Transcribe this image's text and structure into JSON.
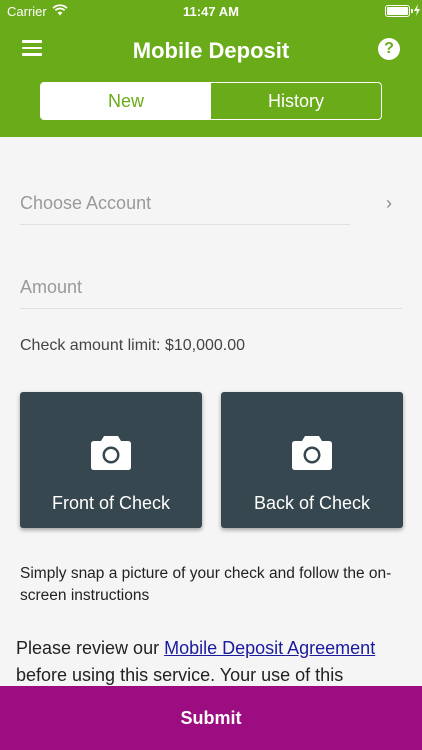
{
  "status_bar": {
    "carrier": "Carrier",
    "time": "11:47 AM"
  },
  "header": {
    "title": "Mobile Deposit"
  },
  "tabs": [
    {
      "label": "New",
      "active": true
    },
    {
      "label": "History",
      "active": false
    }
  ],
  "form": {
    "account_placeholder": "Choose Account",
    "amount_placeholder": "Amount",
    "limit_text": "Check amount limit: $10,000.00"
  },
  "checks": {
    "front_label": "Front of Check",
    "back_label": "Back of Check",
    "icon": "camera-icon"
  },
  "instructions": "Simply snap a picture of your check and follow the on-screen instructions",
  "agreement": {
    "prefix": "Please review our ",
    "link": "Mobile Deposit Agreement",
    "suffix": " before using this service. Your use of this"
  },
  "submit_label": "Submit",
  "colors": {
    "brand_green": "#6aab19",
    "card_dark": "#37474f",
    "submit_magenta": "#9c0d81",
    "link_blue": "#1a1a9e"
  }
}
